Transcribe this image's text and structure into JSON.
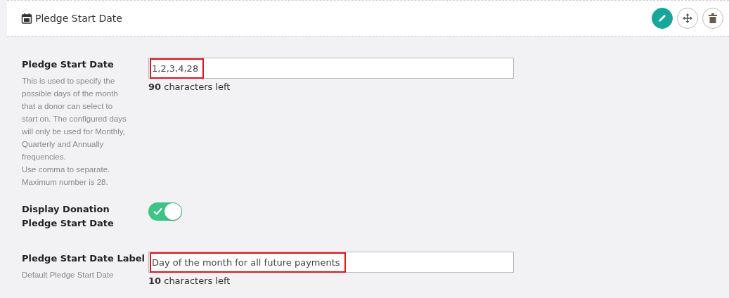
{
  "header": {
    "title": "Pledge Start Date",
    "actions": [
      {
        "kind": "edit",
        "selected": true
      },
      {
        "kind": "move",
        "selected": false
      },
      {
        "kind": "delete",
        "selected": false
      }
    ]
  },
  "fields": [
    {
      "kind": "text",
      "label": "Pledge Start Date",
      "description": [
        "This is used to specify the possible days of the month that a donor can select to start on. The configured days will only be used for Monthly, Quarterly and Annually frequencies.",
        "Use comma to separate.",
        "Maximum number is 28."
      ],
      "value": "1,2,3,4,28",
      "highlighted": true,
      "count": "90",
      "count_text": "characters left"
    },
    {
      "kind": "toggle",
      "label": "Display Donation Pledge Start Date",
      "on": true
    },
    {
      "kind": "text",
      "label": "Pledge Start Date Label",
      "description": [
        "Default Pledge Start Date"
      ],
      "value": "Day of the month for all future payments",
      "highlighted": true,
      "count": "10",
      "count_text": "characters left"
    }
  ]
}
